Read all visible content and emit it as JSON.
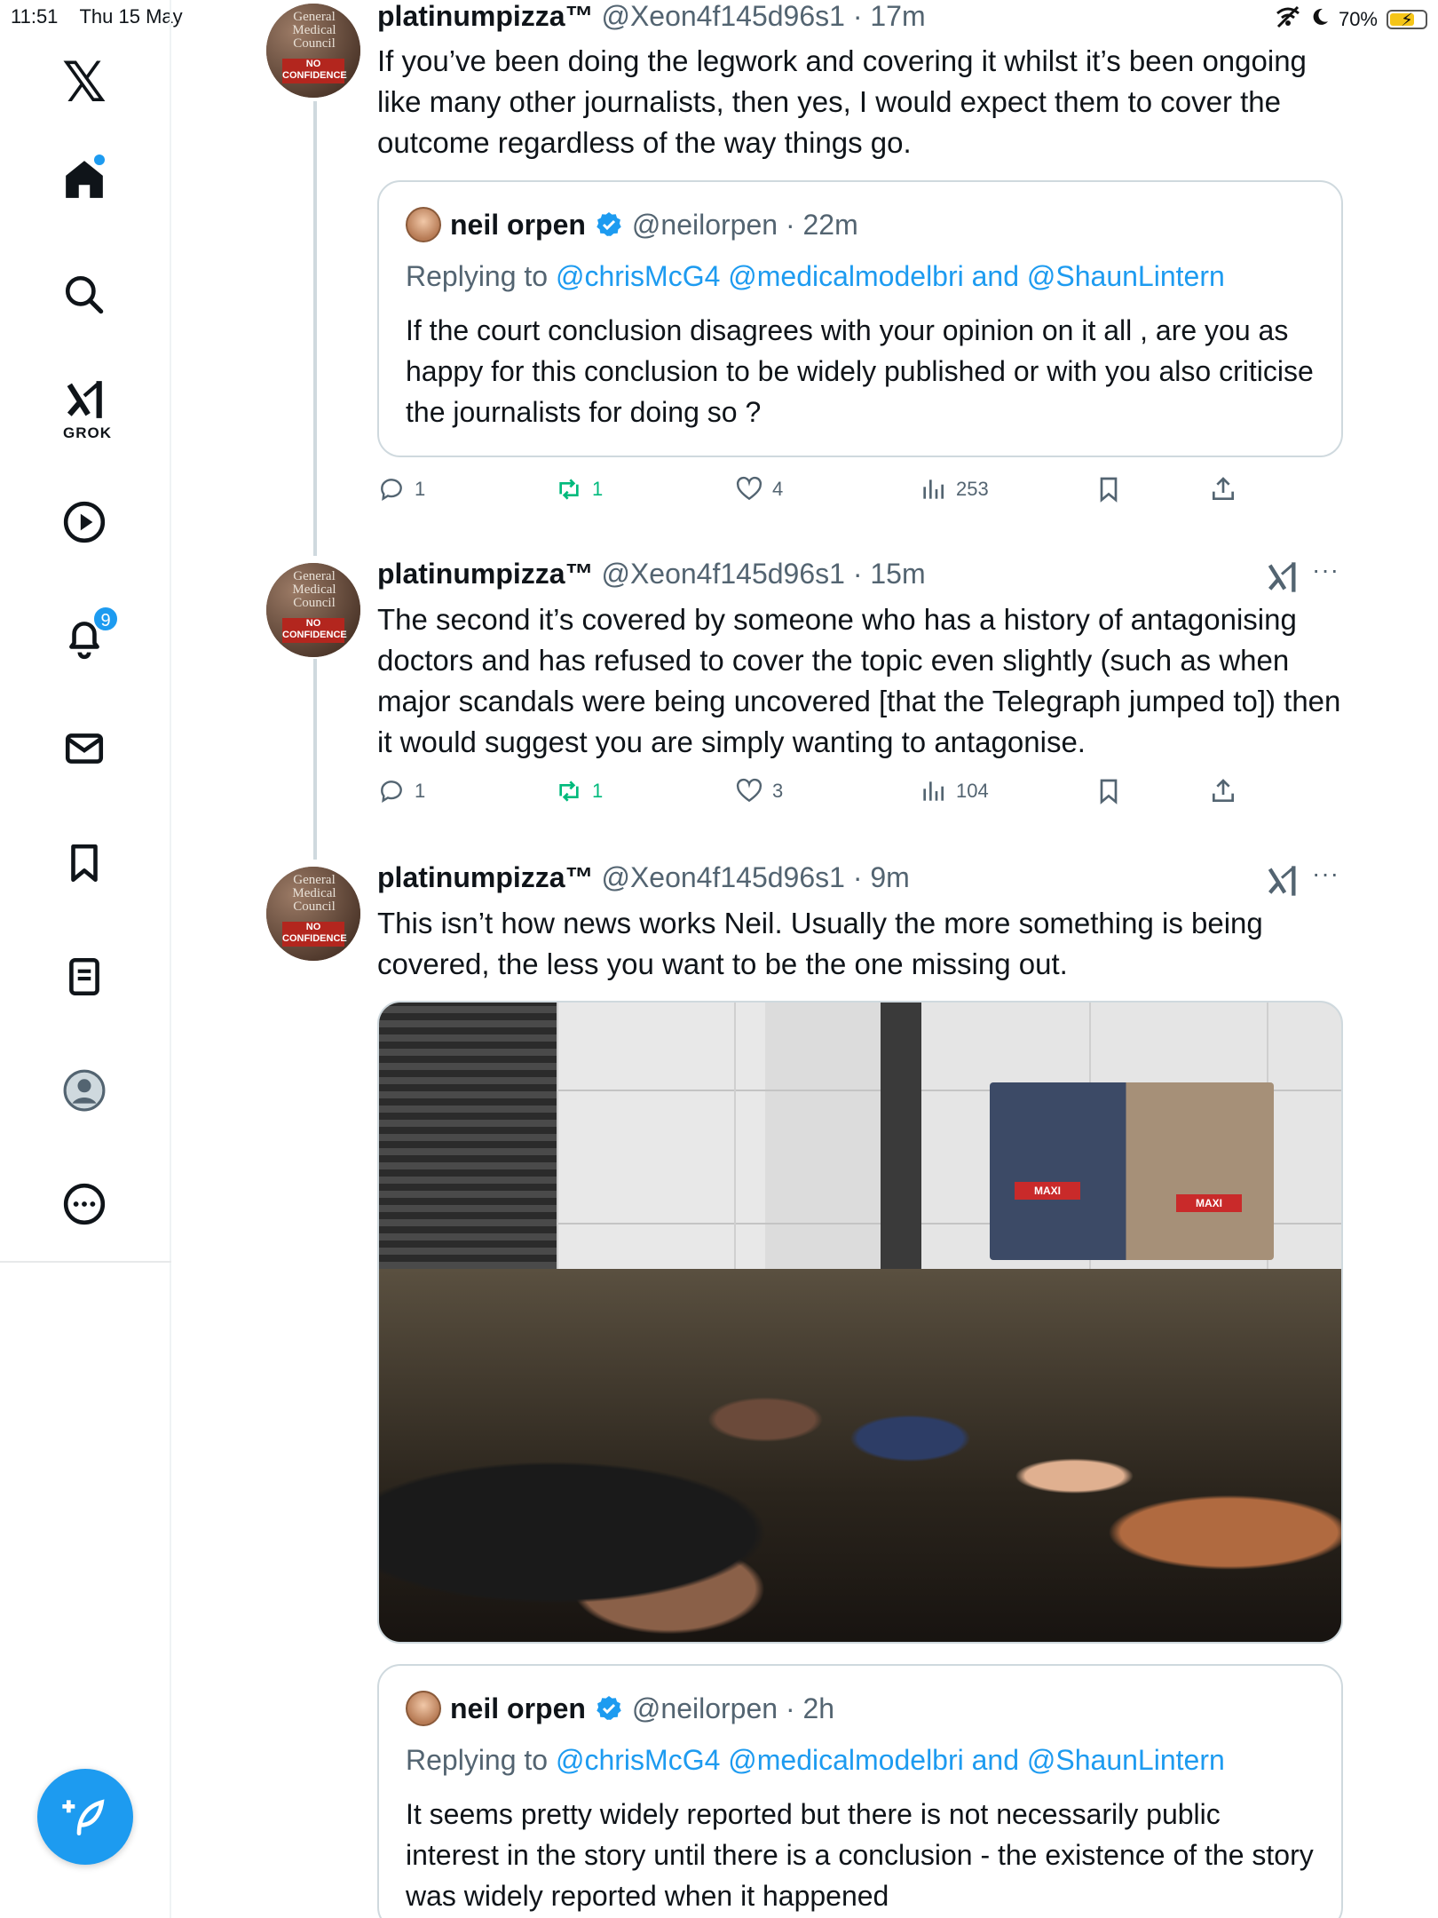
{
  "status_bar": {
    "time": "11:51",
    "date": "Thu 15 May",
    "battery": "70%",
    "battery_level": 0.7
  },
  "sidebar": {
    "logo": "𝕏",
    "grok_label": "GROK",
    "notifications_badge": "9",
    "items": [
      "home",
      "search",
      "grok",
      "video",
      "notifications",
      "messages",
      "bookmarks",
      "lists",
      "profile",
      "more"
    ]
  },
  "colors": {
    "accent": "#1d9bf0",
    "retweet": "#00ba7c",
    "muted": "#536471",
    "border": "#cfd9de"
  },
  "tweets": [
    {
      "name": "platinumpizza™",
      "handle": "@Xeon4f145d96s1 · 17m",
      "text": "If you’ve been doing the legwork and covering it whilst it’s been ongoing like many other journalists, then yes, I would expect them to cover the outcome regardless of the way things go.",
      "quote": {
        "name": "neil orpen",
        "handle": "@neilorpen · 22m",
        "reply_prefix": "Replying to ",
        "reply_to": "@chrisMcG4 @medicalmodelbri and @ShaunLintern",
        "text": "If the court conclusion disagrees with your opinion on it all , are you as happy for this conclusion to be widely published or with you also criticise the journalists for doing so ?"
      },
      "stats": {
        "replies": "1",
        "retweets": "1",
        "likes": "4",
        "views": "253"
      }
    },
    {
      "name": "platinumpizza™",
      "handle": "@Xeon4f145d96s1 · 15m",
      "text": "The second it’s covered by someone who has a history of antagonising doctors and has refused to cover the topic even slightly (such as when major scandals were being uncovered [that the Telegraph jumped to]) then it would suggest you are simply wanting to antagonise.",
      "stats": {
        "replies": "1",
        "retweets": "1",
        "likes": "3",
        "views": "104"
      }
    },
    {
      "name": "platinumpizza™",
      "handle": "@Xeon4f145d96s1 · 9m",
      "text": "This isn’t how news works Neil. Usually the more something is being covered, the less you want to be the one missing out.",
      "quote": {
        "name": "neil orpen",
        "handle": "@neilorpen · 2h",
        "reply_prefix": "Replying to ",
        "reply_to": "@chrisMcG4 @medicalmodelbri and @ShaunLintern",
        "text": "It seems pretty widely reported but there is not necessarily public interest in the story until there is a conclusion - the existence of the story was widely reported when it happened"
      }
    }
  ],
  "avatar_text": {
    "line1": "General Medical Council",
    "stamp": "NO CONFIDENCE"
  },
  "media": {
    "sign1": "MAXI",
    "sign2": "MAXI"
  }
}
